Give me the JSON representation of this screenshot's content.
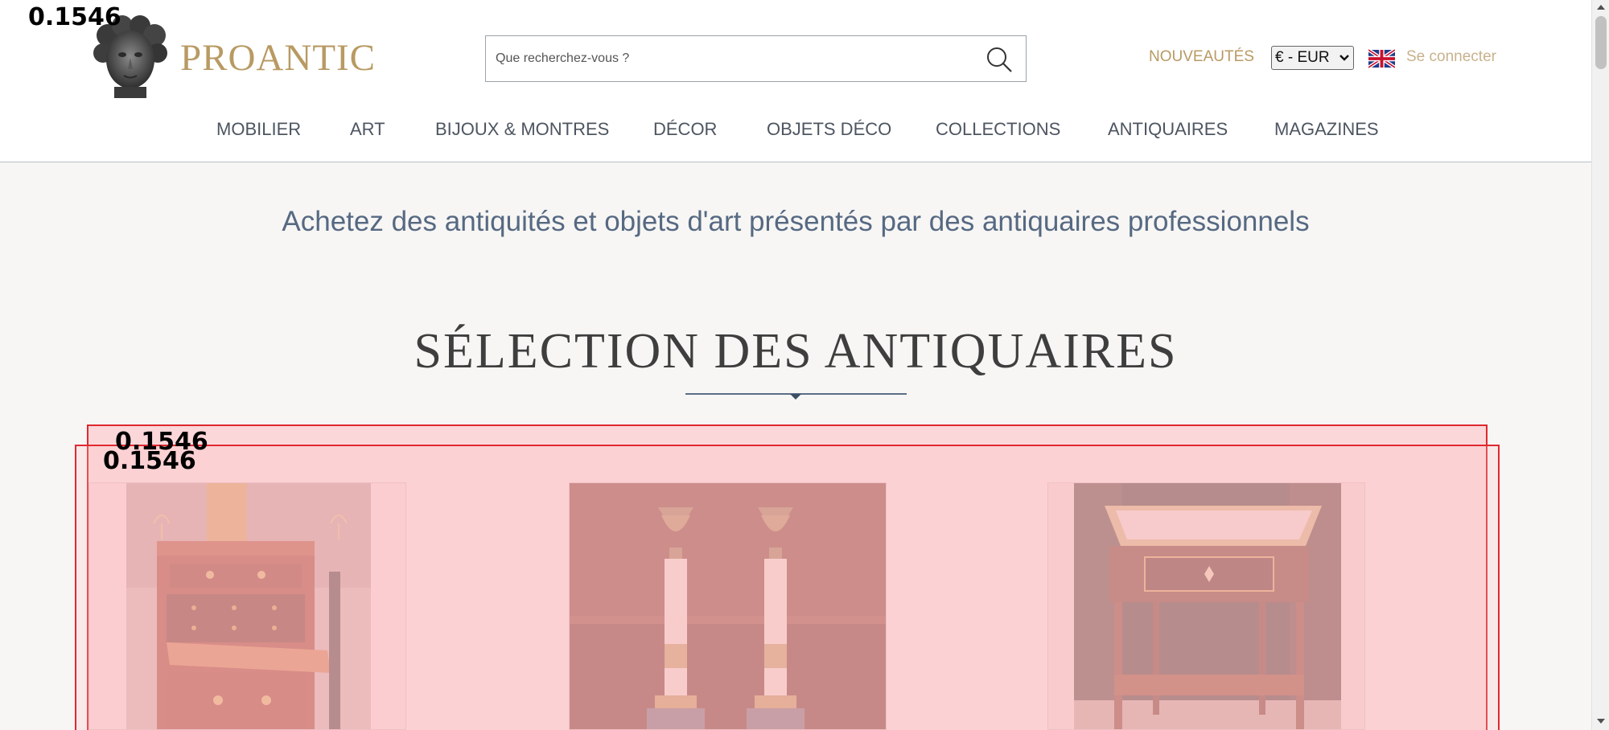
{
  "header": {
    "brand": "PROANTIC",
    "search": {
      "placeholder": "Que recherchez-vous ?",
      "icon": "search-icon"
    },
    "new_link": "NOUVEAUTÉS",
    "currency": {
      "selected": "€ - EUR",
      "icon": "chevron-down-icon"
    },
    "language_flag": "uk-flag-icon",
    "login": "Se connecter"
  },
  "nav": {
    "items": [
      "MOBILIER",
      "ART",
      "BIJOUX & MONTRES",
      "DÉCOR",
      "OBJETS DÉCO",
      "COLLECTIONS",
      "ANTIQUAIRES",
      "MAGAZINES"
    ]
  },
  "main": {
    "tagline": "Achetez des antiquités et objets d'art présentés par des antiquaires professionnels",
    "section_title": "SÉLECTION DES ANTIQUAIRES"
  },
  "overlays": {
    "label_top_left": "0.1546",
    "label_box_1": "0.1546",
    "label_box_2": "0.1546"
  },
  "colors": {
    "brand_gold": "#b89a63",
    "nav_text": "#4d5560",
    "tagline_blue": "#566983",
    "highlight_red": "#e0282f"
  }
}
